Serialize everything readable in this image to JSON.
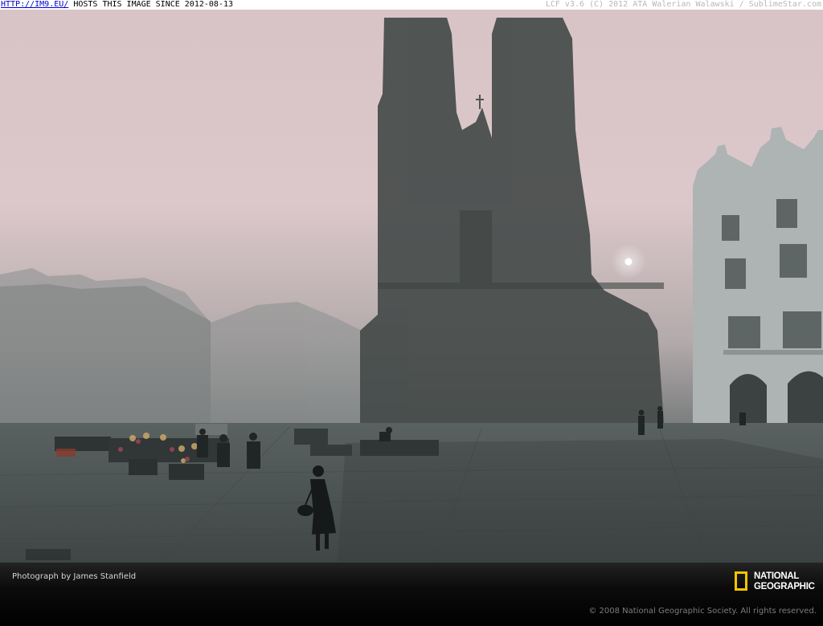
{
  "top_bar": {
    "link_text": "HTTP://IM9.EU/",
    "hosting_text": " HOSTS THIS IMAGE SINCE 2012-08-13",
    "right_text": "LCF v3.6 (C) 2012 ATA Walerian Walawski / SublimeStar.com"
  },
  "caption": {
    "credit": "Photograph by James Stanfield",
    "copyright": "© 2008 National Geographic Society. All rights reserved."
  },
  "logo": {
    "line1": "NATIONAL",
    "line2": "GEOGRAPHIC",
    "icon": "yellow-border-rectangle",
    "accent_color": "#f5c400"
  },
  "colors": {
    "fog_sky": "#d9c3c7",
    "ground": "#4d5352"
  }
}
